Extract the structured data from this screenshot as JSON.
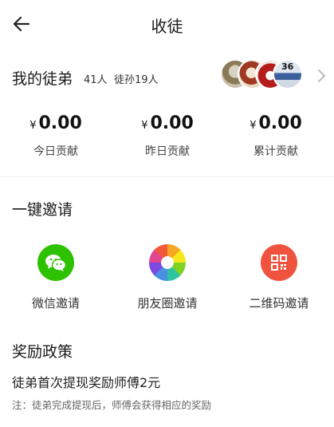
{
  "header": {
    "title": "收徒",
    "back_icon": "arrow-left-icon"
  },
  "disciples": {
    "title": "我的徒弟",
    "count": "41人",
    "grand_count": "徒孙19人",
    "avatar_badge": "36",
    "chevron_icon": "chevron-right-icon"
  },
  "stats": [
    {
      "currency": "¥",
      "value": "0.00",
      "label": "今日贡献"
    },
    {
      "currency": "¥",
      "value": "0.00",
      "label": "昨日贡献"
    },
    {
      "currency": "¥",
      "value": "0.00",
      "label": "累计贡献"
    }
  ],
  "invite": {
    "title": "一键邀请",
    "options": [
      {
        "label": "微信邀请",
        "icon": "wechat-icon",
        "color": "#2dc100"
      },
      {
        "label": "朋友圈邀请",
        "icon": "moments-icon",
        "color": "#f5a623"
      },
      {
        "label": "二维码邀请",
        "icon": "qrcode-icon",
        "color": "#f0533d"
      }
    ]
  },
  "reward": {
    "title": "奖励政策",
    "main": "徒弟首次提现奖励师傅2元",
    "note": "注：徒弟完成提现后，师傅会获得相应的奖励"
  }
}
